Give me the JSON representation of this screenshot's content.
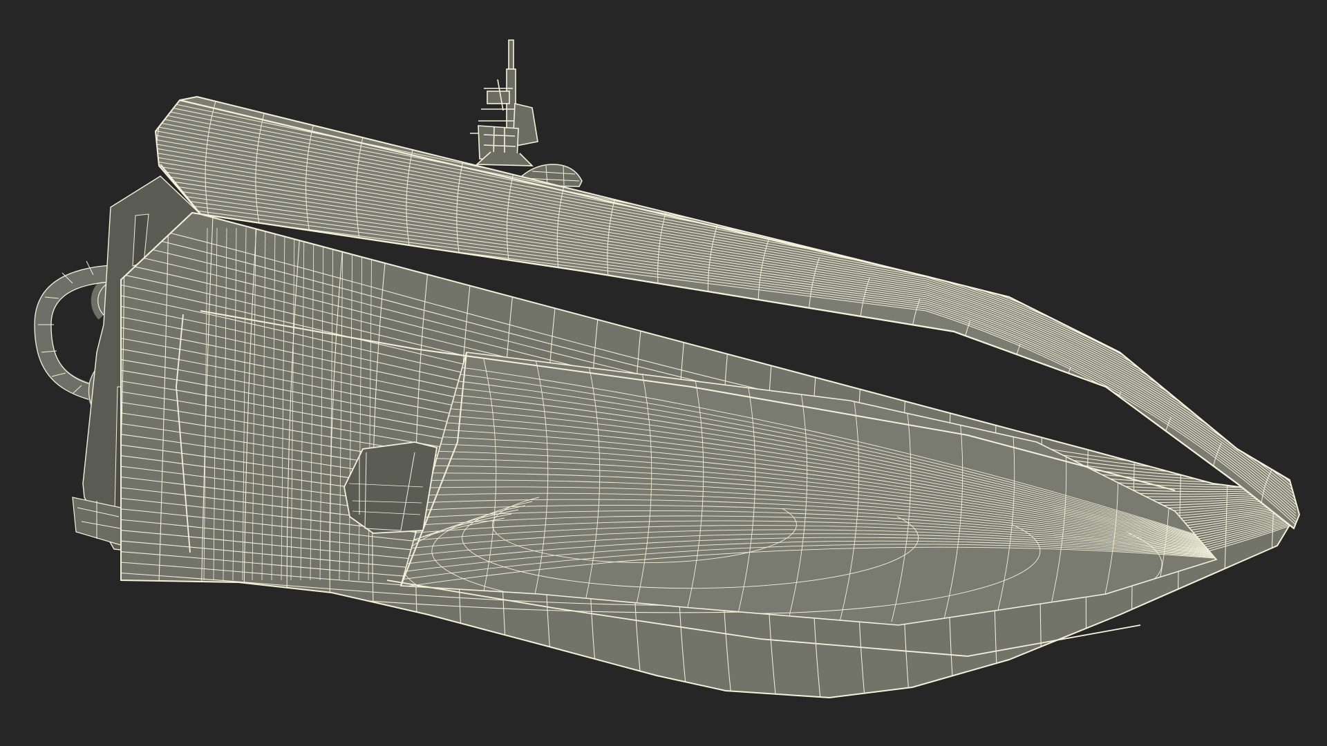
{
  "scene": {
    "subject": "boat-hull-wireframe-render",
    "background_color": "#262626",
    "surface_color": "#737469",
    "surface_dark_color": "#5d5e55",
    "surface_light_color": "#85867b",
    "wire_color": "#f3f3dc"
  }
}
